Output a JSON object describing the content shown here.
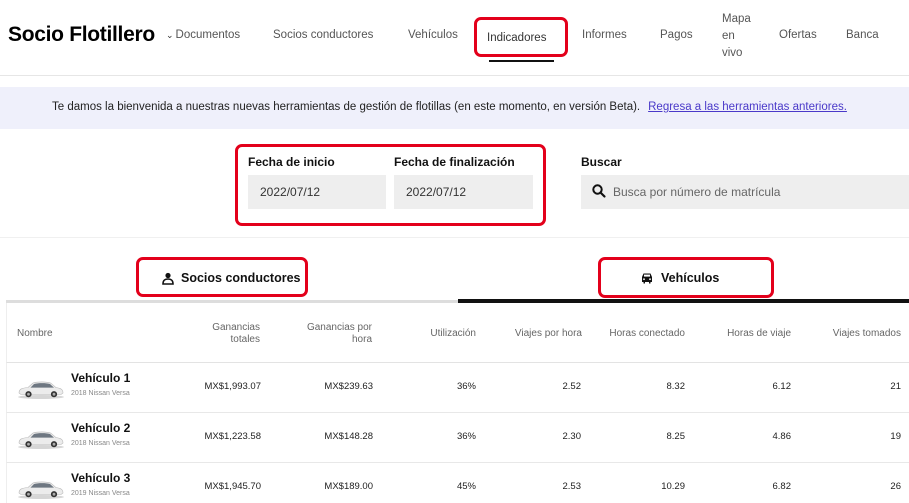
{
  "header": {
    "brand": "Socio Flotillero",
    "nav": {
      "documentos": "Documentos",
      "socios": "Socios conductores",
      "vehiculos": "Vehículos",
      "indicadores": "Indicadores",
      "informes": "Informes",
      "pagos": "Pagos",
      "mapa_line1": "Mapa",
      "mapa_line2": "en",
      "mapa_line3": "vivo",
      "ofertas": "Ofertas",
      "banca": "Banca"
    }
  },
  "banner": {
    "text": "Te damos la bienvenida a nuestras nuevas herramientas de gestión de flotillas (en este momento, en versión Beta).",
    "link": "Regresa a las herramientas anteriores."
  },
  "filters": {
    "start_label": "Fecha de inicio",
    "start_value": "2022/07/12",
    "end_label": "Fecha de finalización",
    "end_value": "2022/07/12",
    "search_label": "Buscar",
    "search_placeholder": "Busca por número de matrícula"
  },
  "tabs": {
    "drivers": "Socios conductores",
    "vehicles": "Vehículos"
  },
  "table": {
    "columns": {
      "name": "Nombre",
      "earnings_l1": "Ganancias",
      "earnings_l2": "totales",
      "per_hour_l1": "Ganancias por",
      "per_hour_l2": "hora",
      "utilization": "Utilización",
      "trips_per_hour": "Viajes por hora",
      "hours_online": "Horas conectado",
      "trip_hours": "Horas de viaje",
      "trips_taken": "Viajes tomados"
    },
    "rows": [
      {
        "name": "Vehículo 1",
        "model": "2018 Nissan Versa",
        "earnings": "MX$1,993.07",
        "per_hour": "MX$239.63",
        "utilization": "36%",
        "trips_per_hour": "2.52",
        "hours_online": "8.32",
        "trip_hours": "6.12",
        "trips": "21"
      },
      {
        "name": "Vehículo 2",
        "model": "2018 Nissan Versa",
        "earnings": "MX$1,223.58",
        "per_hour": "MX$148.28",
        "utilization": "36%",
        "trips_per_hour": "2.30",
        "hours_online": "8.25",
        "trip_hours": "4.86",
        "trips": "19"
      },
      {
        "name": "Vehículo 3",
        "model": "2019 Nissan Versa",
        "earnings": "MX$1,945.70",
        "per_hour": "MX$189.00",
        "utilization": "45%",
        "trips_per_hour": "2.53",
        "hours_online": "10.29",
        "trip_hours": "6.82",
        "trips": "26"
      }
    ]
  },
  "colors": {
    "highlight": "#e3001b",
    "link": "#4a39c9",
    "banner_bg": "#eff0fb"
  },
  "icons": {
    "nav_chevron": "chevron-down-icon",
    "search": "search-icon",
    "drivers_tab": "person-icon",
    "vehicles_tab": "car-icon",
    "vehicle_thumb": "car-image"
  }
}
